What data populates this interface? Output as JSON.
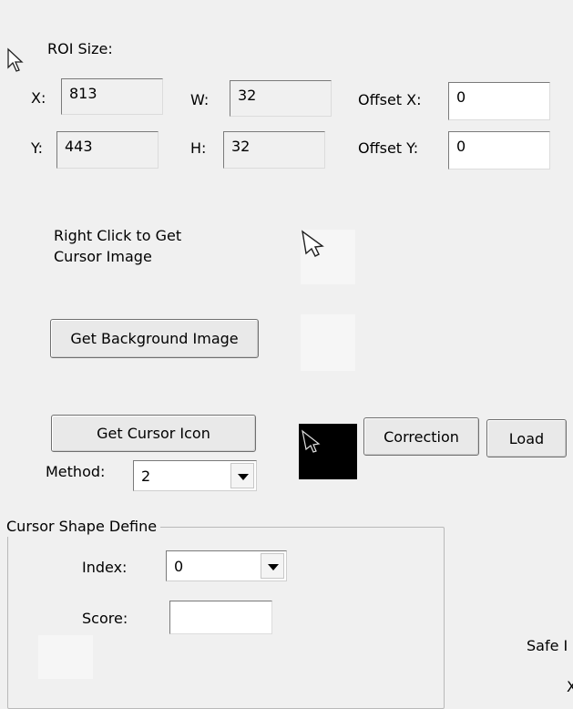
{
  "roi": {
    "title": "ROI Size:",
    "x_label": "X:",
    "x_value": "813",
    "y_label": "Y:",
    "y_value": "443",
    "w_label": "W:",
    "w_value": "32",
    "h_label": "H:",
    "h_value": "32",
    "offset_x_label": "Offset X:",
    "offset_x_value": "0",
    "offset_y_label": "Offset Y:",
    "offset_y_value": "0"
  },
  "cursor_image": {
    "instruction": [
      "Right Click to Get",
      "Cursor Image"
    ]
  },
  "buttons": {
    "get_background": "Get Background Image",
    "get_cursor_icon": "Get Cursor Icon",
    "correction": "Correction",
    "load": "Load"
  },
  "method": {
    "label": "Method:",
    "value": "2"
  },
  "cursor_shape": {
    "title": "Cursor Shape Define",
    "index_label": "Index:",
    "index_value": "0",
    "score_label": "Score:",
    "score_value": ""
  },
  "safe": {
    "label": "Safe I",
    "partial": "X"
  },
  "icons": [
    "cursor-arrow-icon",
    "cursor-preview-icon",
    "chevron-down-icon"
  ]
}
